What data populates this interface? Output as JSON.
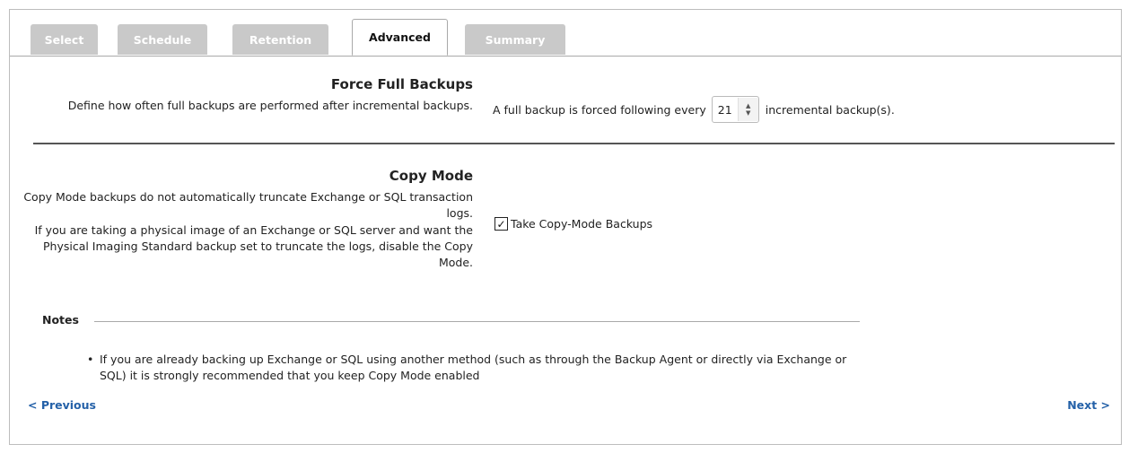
{
  "tabs": [
    {
      "label": "Select"
    },
    {
      "label": "Schedule"
    },
    {
      "label": "Retention"
    },
    {
      "label": "Advanced",
      "active": true
    },
    {
      "label": "Summary"
    }
  ],
  "force_full": {
    "title": "Force Full Backups",
    "description": "Define how often full backups are performed after incremental backups.",
    "prefix": "A full backup is forced following every",
    "value": "21",
    "suffix": "incremental backup(s)."
  },
  "copy_mode": {
    "title": "Copy Mode",
    "description1": "Copy Mode backups do not automatically truncate Exchange or SQL transaction logs.",
    "description2": "If you are taking a physical image of an Exchange or SQL server and want the Physical Imaging Standard backup set to truncate the logs, disable the Copy Mode.",
    "checkbox_label": "Take Copy-Mode Backups",
    "checked": true
  },
  "notes": {
    "heading": "Notes",
    "items": [
      "If you are already backing up Exchange or SQL using another method (such as through the Backup Agent or directly via Exchange or SQL) it is strongly recommended that you keep Copy Mode enabled"
    ]
  },
  "nav": {
    "previous": "< Previous",
    "next": "Next >"
  },
  "colors": {
    "link": "#2461a8",
    "inactive_tab": "#c9c9c9"
  }
}
